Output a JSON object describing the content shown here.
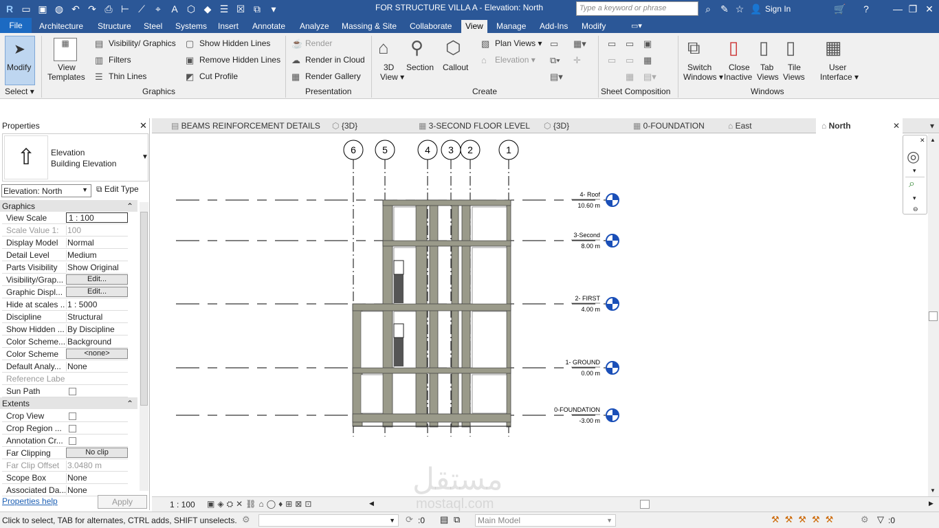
{
  "title": "FOR STRUCTURE VILLA A - Elevation: North",
  "search_placeholder": "Type a keyword or phrase",
  "sign_in": "Sign In",
  "file_tab": "File",
  "tabs": [
    "Architecture",
    "Structure",
    "Steel",
    "Systems",
    "Insert",
    "Annotate",
    "Analyze",
    "Massing & Site",
    "Collaborate",
    "View",
    "Manage",
    "Add-Ins",
    "Modify"
  ],
  "active_tab": "View",
  "ribbon": {
    "modify": "Modify",
    "select": "Select",
    "view_templates": [
      "View",
      "Templates"
    ],
    "visibility_graphics": "Visibility/ Graphics",
    "filters": "Filters",
    "thin_lines": "Thin Lines",
    "show_hidden_lines": "Show Hidden Lines",
    "remove_hidden_lines": "Remove Hidden Lines",
    "cut_profile": "Cut Profile",
    "graphics_panel": "Graphics",
    "render": "Render",
    "render_in_cloud": "Render in Cloud",
    "render_gallery": "Render Gallery",
    "presentation_panel": "Presentation",
    "view_3d": [
      "3D",
      "View"
    ],
    "section": "Section",
    "callout": "Callout",
    "plan_views": "Plan Views",
    "elevation": "Elevation",
    "create_panel": "Create",
    "sheet_composition_panel": "Sheet Composition",
    "switch_windows": [
      "Switch",
      "Windows"
    ],
    "close_inactive": [
      "Close",
      "Inactive"
    ],
    "tab_views": [
      "Tab",
      "Views"
    ],
    "tile_views": [
      "Tile",
      "Views"
    ],
    "user_interface": [
      "User",
      "Interface"
    ],
    "windows_panel": "Windows"
  },
  "properties": {
    "header": "Properties",
    "type_line1": "Elevation",
    "type_line2": "Building Elevation",
    "selector": "Elevation: North",
    "edit_type": "Edit Type",
    "graphics_group": "Graphics",
    "extents_group": "Extents",
    "graphics_rows": [
      {
        "k": "View Scale",
        "v": "1 : 100",
        "kind": "input"
      },
      {
        "k": "Scale Value    1:",
        "v": "100",
        "kind": "dis"
      },
      {
        "k": "Display Model",
        "v": "Normal",
        "kind": "text"
      },
      {
        "k": "Detail Level",
        "v": "Medium",
        "kind": "text"
      },
      {
        "k": "Parts Visibility",
        "v": "Show Original",
        "kind": "text"
      },
      {
        "k": "Visibility/Grap...",
        "v": "Edit...",
        "kind": "btn"
      },
      {
        "k": "Graphic Displ...",
        "v": "Edit...",
        "kind": "btn"
      },
      {
        "k": "Hide at scales ...",
        "v": "1 : 5000",
        "kind": "text"
      },
      {
        "k": "Discipline",
        "v": "Structural",
        "kind": "text"
      },
      {
        "k": "Show Hidden ...",
        "v": "By Discipline",
        "kind": "text"
      },
      {
        "k": "Color Scheme...",
        "v": "Background",
        "kind": "text"
      },
      {
        "k": "Color Scheme",
        "v": "<none>",
        "kind": "btn"
      },
      {
        "k": "Default Analy...",
        "v": "None",
        "kind": "text"
      },
      {
        "k": "Reference Label",
        "v": "",
        "kind": "dis"
      },
      {
        "k": "Sun Path",
        "v": "",
        "kind": "chk"
      }
    ],
    "extents_rows": [
      {
        "k": "Crop View",
        "v": "",
        "kind": "chk"
      },
      {
        "k": "Crop Region ...",
        "v": "",
        "kind": "chk"
      },
      {
        "k": "Annotation Cr...",
        "v": "",
        "kind": "chk"
      },
      {
        "k": "Far Clipping",
        "v": "No clip",
        "kind": "btn"
      },
      {
        "k": "Far Clip Offset",
        "v": "3.0480 m",
        "kind": "dis"
      },
      {
        "k": "Scope Box",
        "v": "None",
        "kind": "text"
      },
      {
        "k": "Associated Da...",
        "v": "None",
        "kind": "text"
      }
    ],
    "help": "Properties help",
    "apply": "Apply"
  },
  "doc_tabs": [
    "BEAMS REINFORCEMENT DETAILS",
    "{3D}",
    "3-SECOND FLOOR LEVEL",
    "{3D}",
    "0-FOUNDATION",
    "East",
    "North"
  ],
  "grids": [
    "6",
    "5",
    "4",
    "3",
    "2",
    "1"
  ],
  "levels": [
    {
      "name": "4- Roof",
      "elev": "10.60 m"
    },
    {
      "name": "3-Second",
      "elev": "8.00 m"
    },
    {
      "name": "2- FIRST",
      "elev": "4.00 m"
    },
    {
      "name": "1- GROUND",
      "elev": "0.00 m"
    },
    {
      "name": "0-FOUNDATION",
      "elev": "-3.00 m"
    }
  ],
  "view_scale": "1 : 100",
  "status_text": "Click to select, TAB for alternates, CTRL adds, SHIFT unselects.",
  "status_zero": ":0",
  "workset": "Main Model",
  "filter_count": ":0",
  "watermark": [
    "مستقل",
    "mostaql.com"
  ]
}
